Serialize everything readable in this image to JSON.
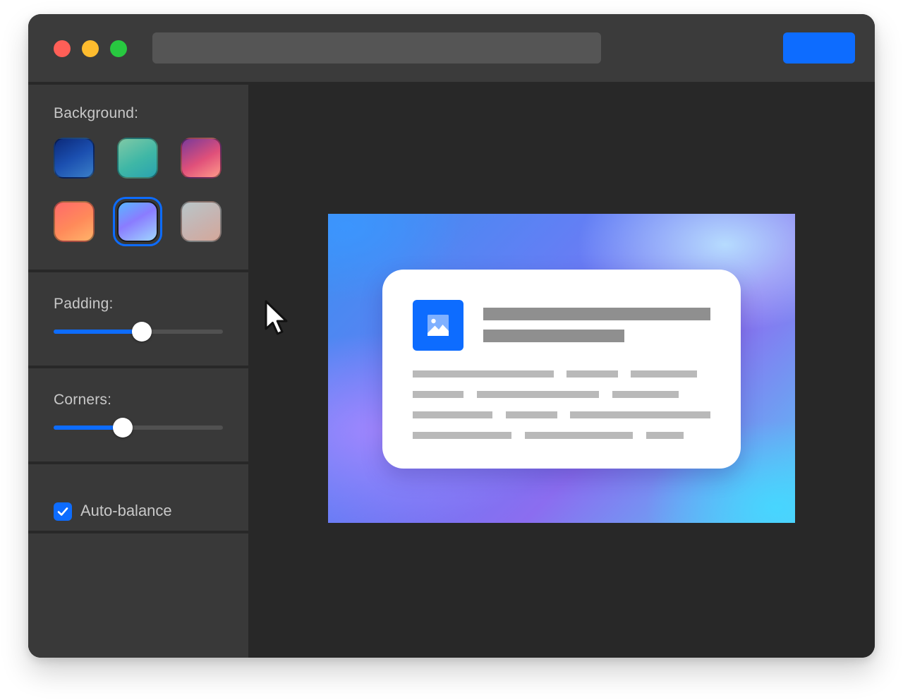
{
  "colors": {
    "accent": "#0d6cff",
    "traffic_close": "#ff5f57",
    "traffic_minimize": "#febc2e",
    "traffic_maximize": "#28c840",
    "window_bg": "#282828",
    "panel_bg": "#393939",
    "titlebar_bg": "#3b3b3b",
    "label_text": "#c8c8c8"
  },
  "titlebar": {
    "traffic_lights": [
      "close",
      "minimize",
      "maximize"
    ],
    "address_bar_value": "",
    "primary_button_label": ""
  },
  "sidebar": {
    "background": {
      "label": "Background:",
      "swatches": [
        {
          "name": "deep-ocean",
          "gradient": "linear-gradient(150deg, #0c2a7a 0%, #1b4fb0 50%, #3a7fc8 100%)",
          "selected": false
        },
        {
          "name": "mint",
          "gradient": "linear-gradient(150deg, #7fc9a6 0%, #3fb7a6 55%, #2aa3b0 100%)",
          "selected": false
        },
        {
          "name": "sunset-pink",
          "gradient": "linear-gradient(150deg, #7a3a9a 0%, #e0507a 55%, #ff9a8a 100%)",
          "selected": false
        },
        {
          "name": "coral",
          "gradient": "linear-gradient(150deg, #ff6a6a 0%, #ff8a5a 55%, #ffb36a 100%)",
          "selected": false
        },
        {
          "name": "aurora",
          "gradient": "linear-gradient(150deg, #59b6ff 0%, #8a7cff 45%, #9fd6ff 100%)",
          "selected": true
        },
        {
          "name": "mist",
          "gradient": "linear-gradient(150deg, #b9c6c8 0%, #c7b3b0 55%, #d4a89a 100%)",
          "selected": false
        }
      ]
    },
    "padding": {
      "label": "Padding:",
      "value": 0.52
    },
    "corners": {
      "label": "Corners:",
      "value": 0.41
    },
    "auto_balance": {
      "label": "Auto-balance",
      "checked": true
    }
  },
  "preview": {
    "card": {
      "icon": "image-icon",
      "title_lines": 2,
      "body_lines": 4
    }
  }
}
